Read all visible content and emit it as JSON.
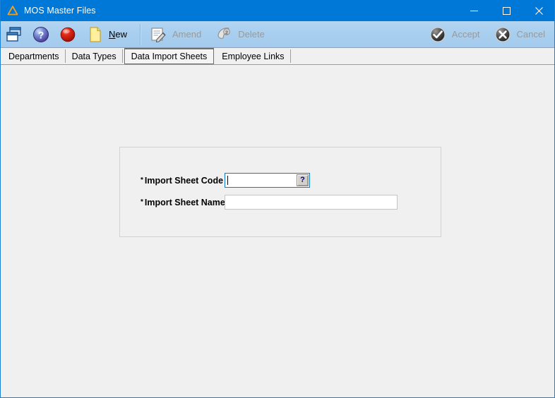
{
  "window": {
    "title": "MOS Master Files",
    "app_icon": "triangle-warning-icon",
    "accent_color": "#0078d7",
    "border_color": "#1b7fd4",
    "background_color": "#f0f0f0",
    "controls": {
      "minimize": "minimize-icon",
      "maximize": "maximize-icon",
      "close": "close-icon"
    }
  },
  "toolbar": {
    "background_color": "#a9cfef",
    "left_icons": [
      {
        "name": "window-cascade-icon",
        "label": ""
      },
      {
        "name": "help-question-icon",
        "label": ""
      },
      {
        "name": "exit-red-sphere-icon",
        "label": ""
      }
    ],
    "new_icon": "new-page-icon",
    "new_label": "New",
    "new_accel": "N",
    "amend_icon": "amend-notepad-pencil-icon",
    "amend_label": "Amend",
    "amend_disabled": true,
    "delete_icon": "delete-icon",
    "delete_label": "Delete",
    "delete_disabled": true,
    "accept_icon": "accept-check-icon",
    "accept_label": "Accept",
    "accept_disabled": true,
    "cancel_icon": "cancel-x-icon",
    "cancel_label": "Cancel",
    "cancel_disabled": true
  },
  "tabs": [
    {
      "label": "Departments",
      "selected": false
    },
    {
      "label": "Data Types",
      "selected": false
    },
    {
      "label": "Data Import Sheets",
      "selected": true
    },
    {
      "label": "Employee Links",
      "selected": false
    }
  ],
  "form": {
    "fields": [
      {
        "required_marker": "*",
        "label": "Import Sheet Code",
        "value": "",
        "placeholder": "",
        "focused": true,
        "has_lookup": true,
        "lookup_glyph": "?",
        "focus_color": "#0f7ac4"
      },
      {
        "required_marker": "*",
        "label": "Import Sheet Name",
        "value": "",
        "placeholder": "",
        "focused": false,
        "has_lookup": false
      }
    ]
  }
}
